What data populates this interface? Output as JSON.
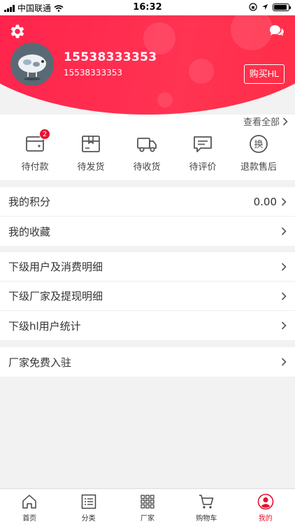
{
  "status_bar": {
    "carrier": "中国联通",
    "time": "16:32"
  },
  "header": {
    "username": "15538333353",
    "phone": "15538333353",
    "buy_button": "购买HL"
  },
  "orders": {
    "view_all": "查看全部",
    "items": [
      {
        "label": "待付款",
        "badge": "2",
        "icon": "wallet-icon"
      },
      {
        "label": "待发货",
        "icon": "box-icon"
      },
      {
        "label": "待收货",
        "icon": "truck-icon"
      },
      {
        "label": "待评价",
        "icon": "comment-icon"
      },
      {
        "label": "退款售后",
        "icon": "exchange-icon"
      }
    ]
  },
  "menu": {
    "points": {
      "label": "我的积分",
      "value": "0.00"
    },
    "favorites": {
      "label": "我的收藏"
    },
    "sub_users": {
      "label": "下级用户及消费明细"
    },
    "sub_factories": {
      "label": "下级厂家及提现明细"
    },
    "hl_stats": {
      "label": "下级hl用户统计"
    },
    "factory_join": {
      "label": "厂家免费入驻"
    }
  },
  "tabbar": {
    "items": [
      {
        "label": "首页",
        "icon": "home-icon"
      },
      {
        "label": "分类",
        "icon": "list-icon"
      },
      {
        "label": "厂家",
        "icon": "grid-icon"
      },
      {
        "label": "购物车",
        "icon": "cart-icon"
      },
      {
        "label": "我的",
        "icon": "profile-icon",
        "active": true
      }
    ]
  },
  "colors": {
    "accent": "#e8102f",
    "header": "#ff2b4a"
  }
}
